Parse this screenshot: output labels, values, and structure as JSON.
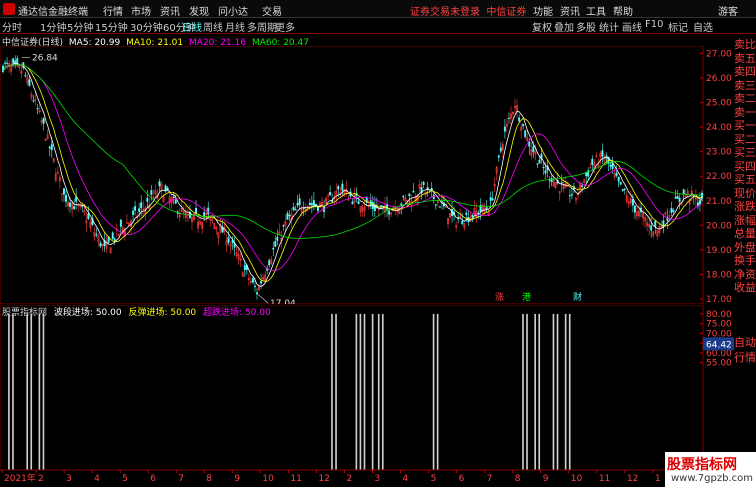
{
  "app": {
    "name": "通达信金融终端",
    "menu": [
      "行情",
      "市场",
      "资讯",
      "发现",
      "问小达",
      "交易"
    ],
    "notice": "证券交易未登录",
    "broker": "中信证券",
    "right_menu": [
      "功能",
      "资讯",
      "工具",
      "帮助",
      "游客"
    ]
  },
  "periods": [
    "分时",
    "1分钟",
    "5分钟",
    "15分钟",
    "30分钟",
    "60分钟",
    "日线",
    "周线",
    "月线",
    "多周期",
    "更多"
  ],
  "tools": [
    "复权",
    "叠加",
    "多股",
    "统计",
    "画线",
    "F10",
    "标记",
    "自选"
  ],
  "stock": {
    "name": "中信证券(日线)",
    "ma5_label": "MA5: 20.99",
    "ma10_label": "MA10: 21.01",
    "ma20_label": "MA20: 21.16",
    "ma60_label": "MA60: 20.47"
  },
  "colors": {
    "up": "#ff3c3c",
    "down": "#54fcfc",
    "ma5": "#ffffff",
    "ma10": "#ffff00",
    "ma20": "#ff00ff",
    "ma60": "#00e000",
    "sell": "#ff4040"
  },
  "chart_data": [
    {
      "type": "candlestick",
      "ylim": [
        16.8,
        27.3
      ],
      "yticks": [
        "27.00",
        "26.00",
        "25.00",
        "24.00",
        "23.00",
        "22.00",
        "21.00",
        "20.00",
        "19.00",
        "18.00",
        "17.00"
      ],
      "annotations": [
        "26.84",
        "17.04"
      ],
      "markers": [
        "涨",
        "港",
        "财"
      ],
      "key_points": [
        [
          0,
          26.5
        ],
        [
          10,
          26.3
        ],
        [
          20,
          24.0
        ],
        [
          30,
          21.2
        ],
        [
          40,
          20.5
        ],
        [
          50,
          19.0
        ],
        [
          60,
          20.0
        ],
        [
          68,
          20.6
        ],
        [
          78,
          21.5
        ],
        [
          85,
          20.8
        ],
        [
          92,
          20.2
        ],
        [
          100,
          20.4
        ],
        [
          110,
          19.6
        ],
        [
          118,
          18.3
        ],
        [
          125,
          17.3
        ],
        [
          132,
          18.8
        ],
        [
          140,
          20.2
        ],
        [
          148,
          20.9
        ],
        [
          158,
          20.8
        ],
        [
          166,
          21.5
        ],
        [
          172,
          21.1
        ],
        [
          180,
          20.8
        ],
        [
          188,
          20.6
        ],
        [
          196,
          20.9
        ],
        [
          206,
          21.5
        ],
        [
          214,
          21.0
        ],
        [
          222,
          20.2
        ],
        [
          230,
          20.4
        ],
        [
          240,
          20.8
        ],
        [
          246,
          23.5
        ],
        [
          252,
          25.0
        ],
        [
          258,
          23.5
        ],
        [
          266,
          22.3
        ],
        [
          274,
          21.6
        ],
        [
          282,
          21.2
        ],
        [
          290,
          22.5
        ],
        [
          296,
          22.8
        ],
        [
          304,
          21.5
        ],
        [
          312,
          20.6
        ],
        [
          318,
          20.0
        ],
        [
          322,
          19.8
        ],
        [
          330,
          20.8
        ],
        [
          336,
          21.3
        ],
        [
          342,
          21.0
        ],
        [
          344,
          20.9
        ]
      ]
    },
    {
      "type": "bar",
      "title": "股票指标网",
      "series": [
        {
          "name": "波段进场",
          "value": "50.00"
        },
        {
          "name": "反弹进场",
          "value": "50.00"
        },
        {
          "name": "超跌进场",
          "value": "50.00"
        }
      ],
      "ylim": [
        0,
        82
      ],
      "yticks": [
        "80.00",
        "75.00",
        "70.00",
        "65.00",
        "60.00",
        "55.00"
      ],
      "current": "64.42",
      "signals": [
        3,
        5,
        12,
        14,
        18,
        20,
        162,
        164,
        174,
        176,
        178,
        182,
        185,
        187,
        212,
        214,
        256,
        258,
        262,
        264,
        271,
        273,
        277,
        279
      ]
    }
  ],
  "xaxis": [
    "2021年",
    "2",
    "3",
    "4",
    "5",
    "6",
    "7",
    "8",
    "9",
    "10",
    "11",
    "12",
    "2",
    "3",
    "4",
    "5",
    "6",
    "7",
    "8",
    "9",
    "10",
    "11",
    "12",
    "1",
    "2"
  ],
  "side": [
    "卖比",
    "卖五",
    "卖四",
    "卖三",
    "卖二",
    "卖一",
    "买一",
    "买二",
    "买三",
    "买四",
    "买五",
    "现价",
    "涨跌",
    "涨幅",
    "总量",
    "外盘",
    "换手",
    "净资",
    "收益"
  ],
  "side2": [
    "自动",
    "行情"
  ],
  "watermark": {
    "line1": "股票指标网",
    "line2": "www.7gpzb.com"
  }
}
